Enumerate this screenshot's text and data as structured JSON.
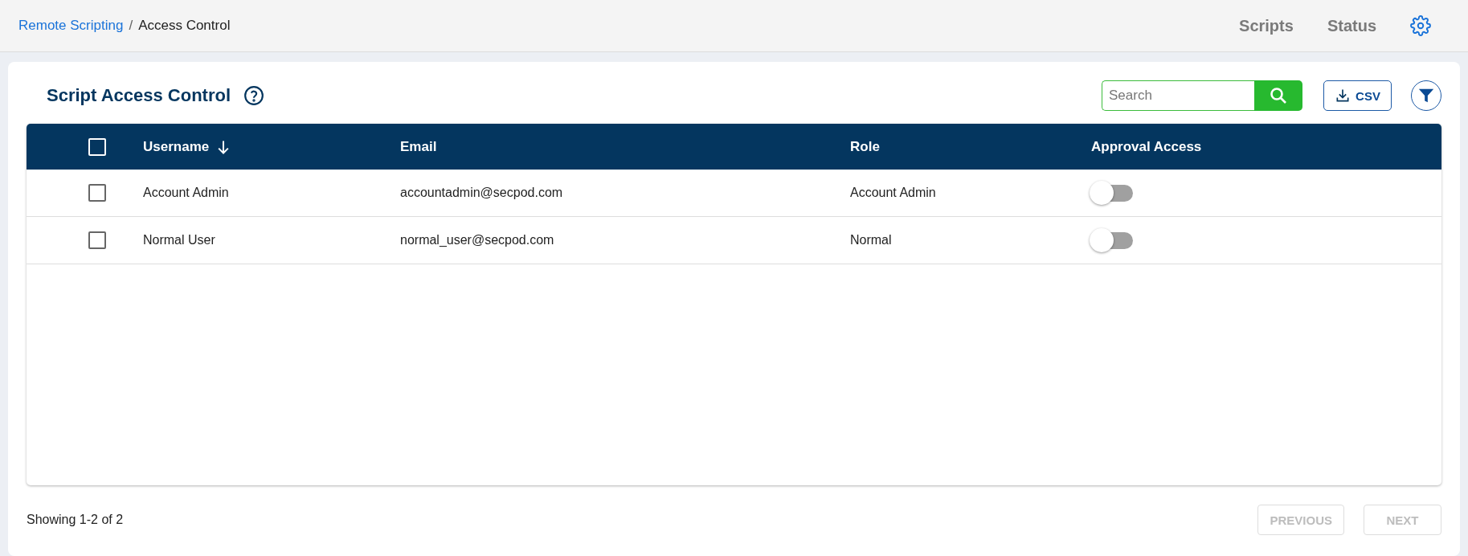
{
  "breadcrumb": {
    "parent": "Remote Scripting",
    "separator": "/",
    "current": "Access Control"
  },
  "nav": [
    {
      "label": "Scripts"
    },
    {
      "label": "Status"
    }
  ],
  "title": "Script Access Control",
  "search": {
    "placeholder": "Search"
  },
  "csv_button": "CSV",
  "table": {
    "all_checked": false,
    "columns": [
      "Username",
      "Email",
      "Role",
      "Approval Access"
    ],
    "rows": [
      {
        "checked": false,
        "username": "Account Admin",
        "email": "accountadmin@secpod.com",
        "role": "Account Admin",
        "approval": false
      },
      {
        "checked": false,
        "username": "Normal User",
        "email": "normal_user@secpod.com",
        "role": "Normal",
        "approval": false
      }
    ]
  },
  "footer": {
    "showing": "Showing 1-2 of 2",
    "previous": "PREVIOUS",
    "next": "NEXT",
    "previous_disabled": true,
    "next_disabled": true
  }
}
